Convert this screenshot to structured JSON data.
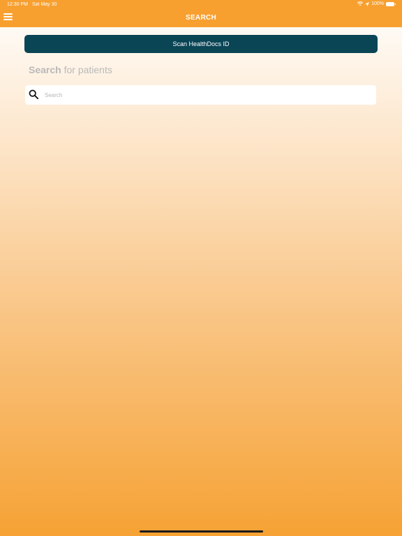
{
  "status_bar": {
    "time": "12:30 PM",
    "date": "Sat May 30",
    "battery": "100%",
    "icons": [
      "wifi-icon",
      "location-arrow-icon",
      "battery-icon"
    ]
  },
  "nav": {
    "title": "SEARCH",
    "menu_icon": "hamburger-menu-icon"
  },
  "main": {
    "scan_button_label": "Scan HealthDocs ID",
    "heading_bold": "Search",
    "heading_rest": " for patients",
    "search": {
      "placeholder": "Search",
      "value": "",
      "icon": "search-icon"
    }
  },
  "colors": {
    "header": "#f7a030",
    "scan_button": "#0a4556",
    "gradient_top": "#ffffff",
    "gradient_bottom": "#f6a234"
  }
}
